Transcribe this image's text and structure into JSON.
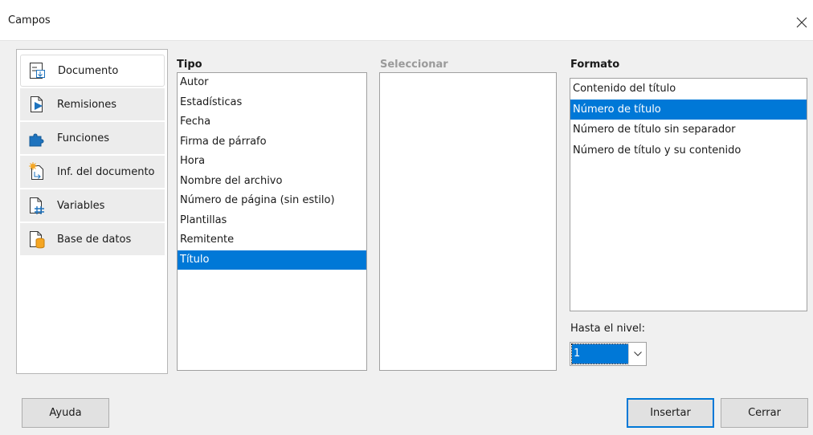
{
  "window": {
    "title": "Campos",
    "close_icon": "close-icon"
  },
  "sidebar": {
    "items": [
      {
        "label": "Documento",
        "icon": "document-icon",
        "active": true
      },
      {
        "label": "Remisiones",
        "icon": "cross-references-icon"
      },
      {
        "label": "Funciones",
        "icon": "puzzle-icon"
      },
      {
        "label": "Inf. del documento",
        "icon": "document-info-icon"
      },
      {
        "label": "Variables",
        "icon": "variables-icon"
      },
      {
        "label": "Base de datos",
        "icon": "database-icon"
      }
    ]
  },
  "tipo": {
    "header": "Tipo",
    "items": [
      "Autor",
      "Estadísticas",
      "Fecha",
      "Firma de párrafo",
      "Hora",
      "Nombre del archivo",
      "Número de página (sin estilo)",
      "Plantillas",
      "Remitente",
      "Título"
    ],
    "selected": "Título"
  },
  "seleccionar": {
    "header": "Seleccionar",
    "items": []
  },
  "formato": {
    "header": "Formato",
    "items": [
      "Contenido del título",
      "Número de título",
      "Número de título sin separador",
      "Número de título y su contenido"
    ],
    "selected": "Número de título"
  },
  "level": {
    "label": "Hasta el nivel:",
    "value": "1"
  },
  "buttons": {
    "help": "Ayuda",
    "insert": "Insertar",
    "close": "Cerrar"
  },
  "colors": {
    "selection": "#0078d7",
    "background": "#f0f0f0"
  }
}
